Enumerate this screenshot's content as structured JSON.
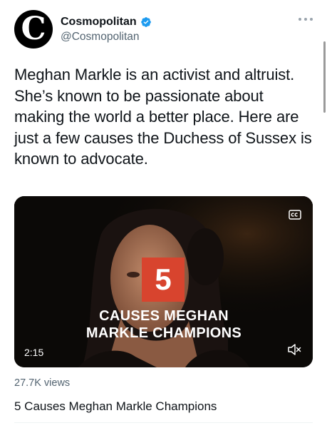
{
  "header": {
    "display_name": "Cosmopolitan",
    "handle": "@Cosmopolitan",
    "avatar_letter": "C",
    "verified_color": "#1d9bf0"
  },
  "tweet": {
    "text": "Meghan Markle is an activist and altruist. She’s known to be passionate about making the world a better place. Here are just a few causes the Duchess of Sussex is known to advocate."
  },
  "video": {
    "overlay_number": "5",
    "overlay_caption": "CAUSES MEGHAN MARKLE CHAMPIONS",
    "duration": "2:15",
    "accent_color": "#d8442e"
  },
  "stats": {
    "views": "27.7K views"
  },
  "card": {
    "title": "5 Causes Meghan Markle Champions"
  }
}
